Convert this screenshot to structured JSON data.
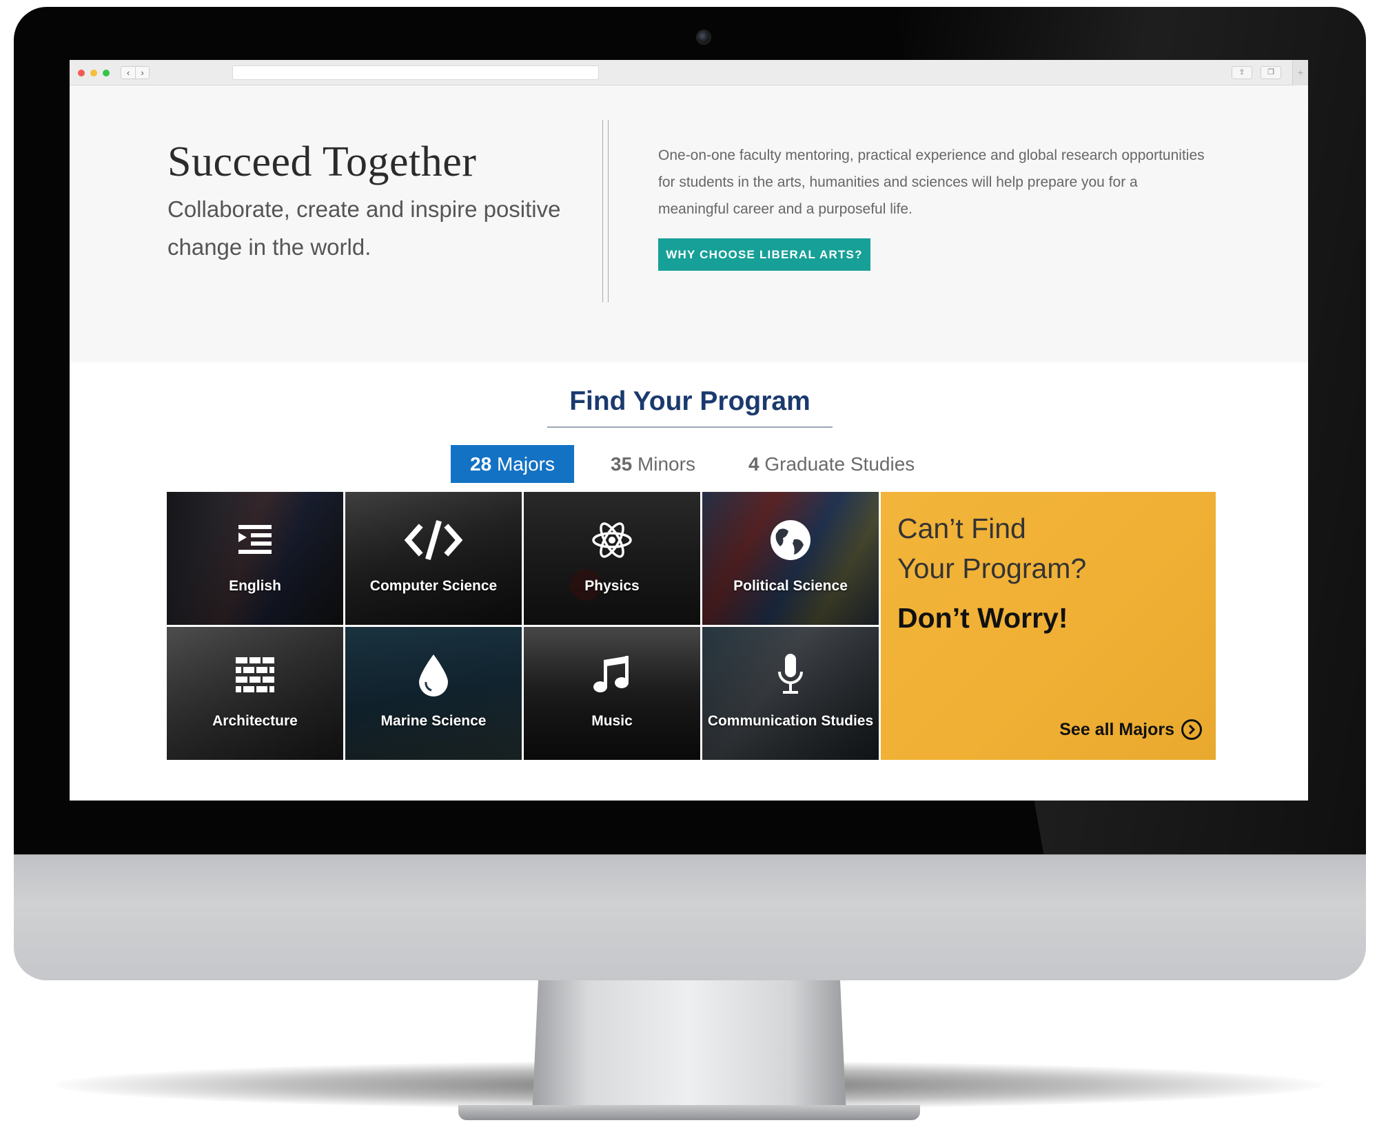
{
  "hero": {
    "title": "Succeed Together",
    "subtitle": "Collaborate, create and inspire positive change in the world.",
    "description": "One-on-one faculty mentoring, practical experience and global research opportunities for students in the arts, humanities and sciences will help prepare you for a meaningful career and a purposeful life.",
    "cta_label": "WHY CHOOSE LIBERAL ARTS?"
  },
  "programs": {
    "title": "Find Your Program",
    "tabs": [
      {
        "count": "28",
        "label": "Majors",
        "active": true
      },
      {
        "count": "35",
        "label": "Minors",
        "active": false
      },
      {
        "count": "4",
        "label": "Graduate Studies",
        "active": false
      }
    ],
    "tiles": [
      {
        "label": "English",
        "icon": "indent-list-icon"
      },
      {
        "label": "Computer Science",
        "icon": "code-icon"
      },
      {
        "label": "Physics",
        "icon": "atom-icon"
      },
      {
        "label": "Political Science",
        "icon": "globe-icon"
      },
      {
        "label": "Architecture",
        "icon": "brick-wall-icon"
      },
      {
        "label": "Marine Science",
        "icon": "water-drop-icon"
      },
      {
        "label": "Music",
        "icon": "music-note-icon"
      },
      {
        "label": "Communication Studies",
        "icon": "microphone-icon"
      }
    ],
    "promo": {
      "line1": "Can’t Find",
      "line2": "Your Program?",
      "line3": "Don’t Worry!",
      "link_label": "See all Majors"
    }
  },
  "colors": {
    "accent_teal": "#17a097",
    "tab_blue": "#1372c4",
    "heading_navy": "#1a3a6e",
    "promo_yellow": "#f2b43a"
  }
}
